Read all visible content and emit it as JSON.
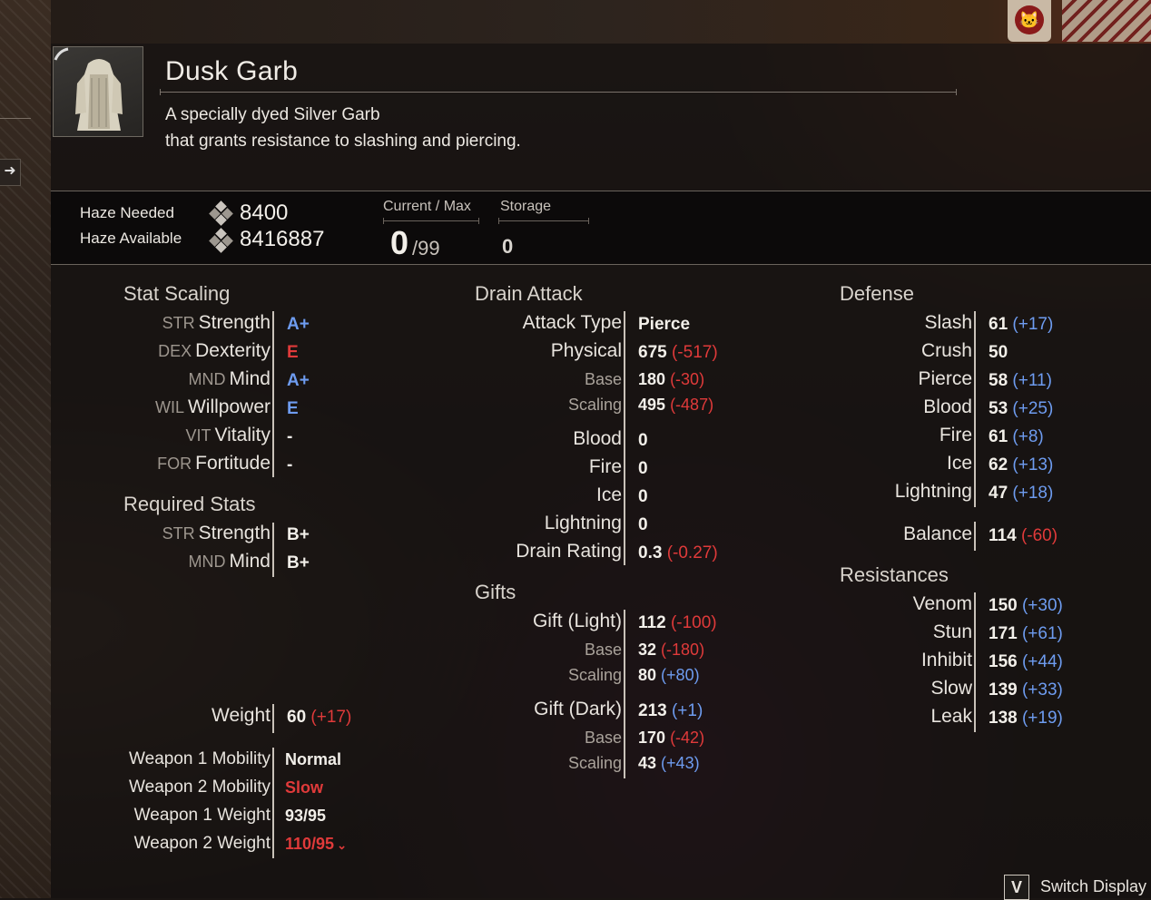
{
  "item": {
    "name": "Dusk Garb",
    "description_line1": "A specially dyed Silver Garb",
    "description_line2": "that grants resistance to slashing and piercing."
  },
  "haze": {
    "needed_label": "Haze Needed",
    "needed_value": "8400",
    "available_label": "Haze Available",
    "available_value": "8416887",
    "current_max_label": "Current / Max",
    "current": "0",
    "max": "/99",
    "storage_label": "Storage",
    "storage_value": "0"
  },
  "stat_scaling": {
    "title": "Stat Scaling",
    "rows": [
      {
        "abbr": "STR",
        "name": "Strength",
        "grade": "A+",
        "color": "blue"
      },
      {
        "abbr": "DEX",
        "name": "Dexterity",
        "grade": "E",
        "color": "red"
      },
      {
        "abbr": "MND",
        "name": "Mind",
        "grade": "A+",
        "color": "blue"
      },
      {
        "abbr": "WIL",
        "name": "Willpower",
        "grade": "E",
        "color": "blue"
      },
      {
        "abbr": "VIT",
        "name": "Vitality",
        "grade": "-",
        "color": "white"
      },
      {
        "abbr": "FOR",
        "name": "Fortitude",
        "grade": "-",
        "color": "white"
      }
    ]
  },
  "required_stats": {
    "title": "Required Stats",
    "rows": [
      {
        "abbr": "STR",
        "name": "Strength",
        "grade": "B+"
      },
      {
        "abbr": "MND",
        "name": "Mind",
        "grade": "B+"
      }
    ]
  },
  "weight": {
    "label": "Weight",
    "value": "60",
    "delta": "(+17)"
  },
  "mobility": [
    {
      "label": "Weapon 1 Mobility",
      "value": "Normal",
      "color": "white"
    },
    {
      "label": "Weapon 2 Mobility",
      "value": "Slow",
      "color": "red"
    },
    {
      "label": "Weapon 1 Weight",
      "value": "93/95",
      "color": "white"
    },
    {
      "label": "Weapon 2 Weight",
      "value": "110/95",
      "color": "red"
    }
  ],
  "drain_attack": {
    "title": "Drain Attack",
    "attack_type_label": "Attack Type",
    "attack_type_value": "Pierce",
    "physical": {
      "label": "Physical",
      "value": "675",
      "delta": "(-517)"
    },
    "physical_base": {
      "label": "Base",
      "value": "180",
      "delta": "(-30)"
    },
    "physical_scaling": {
      "label": "Scaling",
      "value": "495",
      "delta": "(-487)"
    },
    "elements": [
      {
        "label": "Blood",
        "value": "0"
      },
      {
        "label": "Fire",
        "value": "0"
      },
      {
        "label": "Ice",
        "value": "0"
      },
      {
        "label": "Lightning",
        "value": "0"
      }
    ],
    "drain_rating": {
      "label": "Drain Rating",
      "value": "0.3",
      "delta": "(-0.27)"
    }
  },
  "gifts": {
    "title": "Gifts",
    "light": {
      "label": "Gift (Light)",
      "value": "112",
      "delta": "(-100)"
    },
    "light_base": {
      "label": "Base",
      "value": "32",
      "delta": "(-180)"
    },
    "light_scaling": {
      "label": "Scaling",
      "value": "80",
      "delta": "(+80)"
    },
    "dark": {
      "label": "Gift (Dark)",
      "value": "213",
      "delta": "(+1)"
    },
    "dark_base": {
      "label": "Base",
      "value": "170",
      "delta": "(-42)"
    },
    "dark_scaling": {
      "label": "Scaling",
      "value": "43",
      "delta": "(+43)"
    }
  },
  "defense": {
    "title": "Defense",
    "rows": [
      {
        "label": "Slash",
        "value": "61",
        "delta": "(+17)"
      },
      {
        "label": "Crush",
        "value": "50",
        "delta": ""
      },
      {
        "label": "Pierce",
        "value": "58",
        "delta": "(+11)"
      },
      {
        "label": "Blood",
        "value": "53",
        "delta": "(+25)"
      },
      {
        "label": "Fire",
        "value": "61",
        "delta": "(+8)"
      },
      {
        "label": "Ice",
        "value": "62",
        "delta": "(+13)"
      },
      {
        "label": "Lightning",
        "value": "47",
        "delta": "(+18)"
      }
    ],
    "balance": {
      "label": "Balance",
      "value": "114",
      "delta": "(-60)"
    }
  },
  "resistances": {
    "title": "Resistances",
    "rows": [
      {
        "label": "Venom",
        "value": "150",
        "delta": "(+30)"
      },
      {
        "label": "Stun",
        "value": "171",
        "delta": "(+61)"
      },
      {
        "label": "Inhibit",
        "value": "156",
        "delta": "(+44)"
      },
      {
        "label": "Slow",
        "value": "139",
        "delta": "(+33)"
      },
      {
        "label": "Leak",
        "value": "138",
        "delta": "(+19)"
      }
    ]
  },
  "footer": {
    "key": "V",
    "switch_label": "Switch Display"
  },
  "colors": {
    "positive": "#6e9cf0",
    "negative": "#e03a3a"
  },
  "icons": [
    "haze-icon",
    "arrow-right-icon",
    "cat-emblem-icon",
    "chevron-down-icon"
  ]
}
